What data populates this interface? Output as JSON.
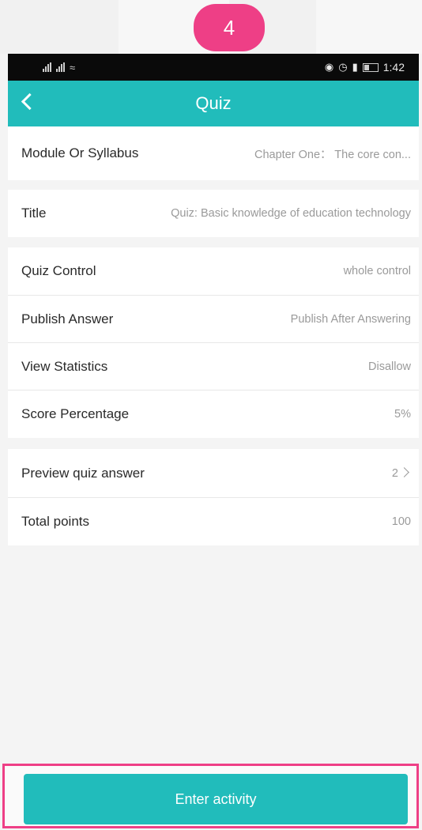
{
  "step_badge": "4",
  "status_bar": {
    "time": "1:42"
  },
  "header": {
    "title": "Quiz"
  },
  "rows": {
    "module": {
      "label": "Module Or Syllabus",
      "value": "Chapter One： The core con..."
    },
    "title": {
      "label": "Title",
      "value": "Quiz: Basic knowledge of education technology"
    },
    "quiz_control": {
      "label": "Quiz Control",
      "value": "whole control"
    },
    "publish_answer": {
      "label": "Publish Answer",
      "value": "Publish After Answering"
    },
    "view_statistics": {
      "label": "View Statistics",
      "value": "Disallow"
    },
    "score_percentage": {
      "label": "Score Percentage",
      "value": "5%"
    },
    "preview": {
      "label": "Preview quiz answer",
      "value": "2"
    },
    "total_points": {
      "label": "Total points",
      "value": "100"
    }
  },
  "footer": {
    "button_label": "Enter activity"
  },
  "colors": {
    "accent": "#21bcbb",
    "highlight": "#ee3f86"
  }
}
